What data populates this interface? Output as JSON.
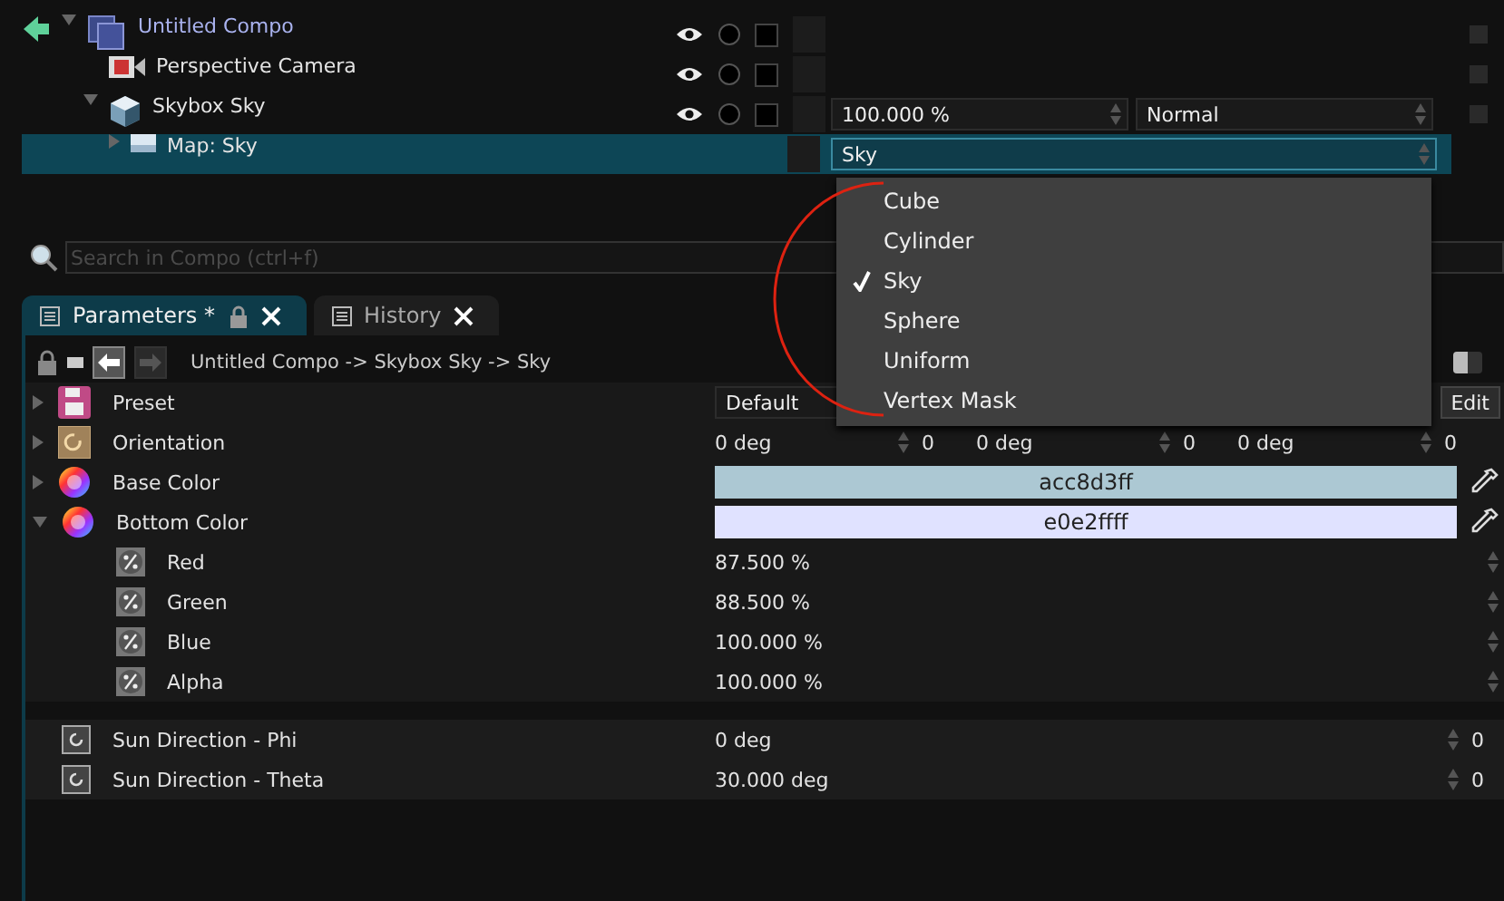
{
  "tree": [
    {
      "kind": "compo",
      "name": "Untitled Compo",
      "expanded": true,
      "selected": false,
      "visible": true,
      "children": [
        {
          "kind": "camera",
          "name": "Perspective Camera",
          "selected": false,
          "visible": true
        },
        {
          "kind": "skybox",
          "name": "Skybox Sky",
          "expanded": true,
          "selected": false,
          "visible": true,
          "opacity": "100.000 %",
          "blend": "Normal",
          "children": [
            {
              "kind": "map",
              "name": "Map: Sky",
              "expanded": false,
              "selected": true,
              "value": "Sky"
            }
          ]
        }
      ]
    }
  ],
  "dropdown": {
    "options": [
      {
        "label": "Cube",
        "selected": false
      },
      {
        "label": "Cylinder",
        "selected": false
      },
      {
        "label": "Sky",
        "selected": true
      },
      {
        "label": "Sphere",
        "selected": false
      },
      {
        "label": "Uniform",
        "selected": false
      },
      {
        "label": "Vertex Mask",
        "selected": false
      }
    ]
  },
  "search": {
    "placeholder": "Search in Compo (ctrl+f)"
  },
  "tabs": [
    {
      "label": "Parameters *",
      "selected": true
    },
    {
      "label": "History",
      "selected": false
    }
  ],
  "breadcrumb": "Untitled Compo -> Skybox Sky -> Sky",
  "params": [
    {
      "kind": "preset",
      "name": "Preset",
      "expanded": false,
      "value": "Default",
      "button": "Edit"
    },
    {
      "kind": "angle3",
      "name": "Orientation",
      "expanded": false,
      "values": [
        {
          "value": "0 deg",
          "step": "0"
        },
        {
          "value": "0 deg",
          "step": "0"
        },
        {
          "value": "0 deg",
          "step": "0"
        }
      ]
    },
    {
      "kind": "color",
      "name": "Base Color",
      "expanded": false,
      "value": "acc8d3ff",
      "color": "#acc8d3"
    },
    {
      "kind": "color",
      "name": "Bottom Color",
      "expanded": true,
      "value": "e0e2ffff",
      "color": "#e0e2ff",
      "children": [
        {
          "kind": "percent",
          "name": "Red",
          "value": "87.500 %"
        },
        {
          "kind": "percent",
          "name": "Green",
          "value": "88.500 %"
        },
        {
          "kind": "percent",
          "name": "Blue",
          "value": "100.000 %"
        },
        {
          "kind": "percent",
          "name": "Alpha",
          "value": "100.000 %"
        }
      ]
    }
  ],
  "sun_params": [
    {
      "kind": "angle",
      "name": "Sun Direction - Phi",
      "value": "0 deg",
      "step": "0"
    },
    {
      "kind": "angle",
      "name": "Sun Direction - Theta",
      "value": "30.000 deg",
      "step": "0"
    }
  ]
}
